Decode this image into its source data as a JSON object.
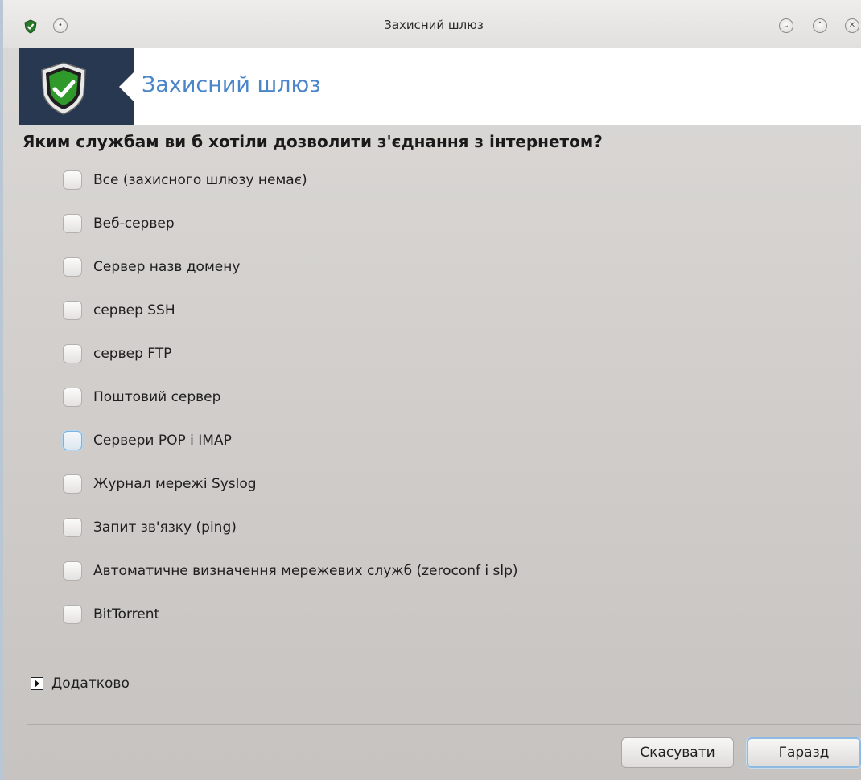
{
  "window": {
    "title": "Захисний шлюз",
    "controls": {
      "menu": "•",
      "minimize": "⌄",
      "maximize": "⌃",
      "close": "✕"
    }
  },
  "header": {
    "title": "Захисний шлюз",
    "logo_icon": "shield-check-icon"
  },
  "question": "Яким службам ви б хотіли дозволити з'єднання з інтернетом?",
  "options": [
    {
      "label": "Все (захисного шлюзу немає)",
      "checked": false
    },
    {
      "label": "Веб-сервер",
      "checked": false
    },
    {
      "label": "Сервер назв домену",
      "checked": false
    },
    {
      "label": "сервер SSH",
      "checked": false
    },
    {
      "label": "сервер FTP",
      "checked": false
    },
    {
      "label": "Поштовий сервер",
      "checked": false
    },
    {
      "label": "Сервери POP і IMAP",
      "checked": false,
      "focused": true
    },
    {
      "label": "Журнал мережі Syslog",
      "checked": false
    },
    {
      "label": "Запит зв'язку (ping)",
      "checked": false
    },
    {
      "label": "Автоматичне визначення мережевих служб (zeroconf і slp)",
      "checked": false
    },
    {
      "label": "BitTorrent",
      "checked": false
    }
  ],
  "advanced": {
    "label": "Додатково"
  },
  "buttons": {
    "cancel": "Скасувати",
    "ok": "Гаразд"
  },
  "colors": {
    "accent": "#4a86c8",
    "logo_bg": "#283850",
    "shield_green": "#2f9a2a"
  }
}
